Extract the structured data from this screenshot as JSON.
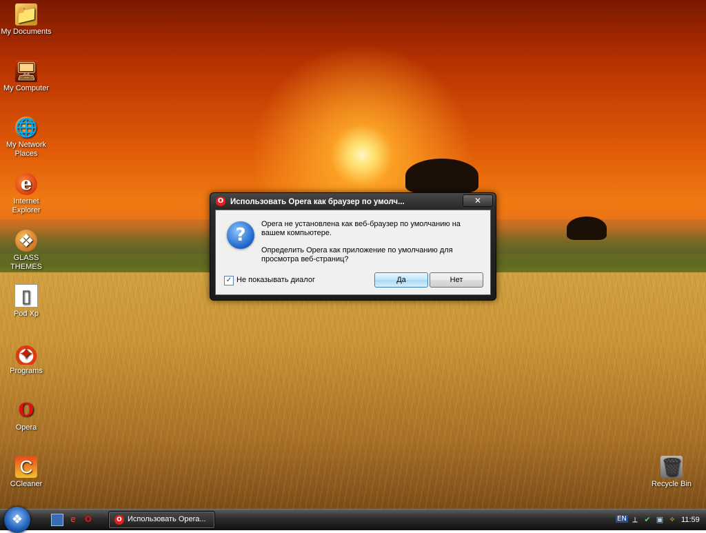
{
  "desktop": {
    "icons": [
      {
        "label": "My Documents",
        "icon": "folder-documents-icon",
        "glyph": "📁"
      },
      {
        "label": "My Computer",
        "icon": "computer-icon",
        "glyph": "🖥"
      },
      {
        "label": "My Network Places",
        "icon": "network-icon",
        "glyph": "🌐"
      },
      {
        "label": "Internet Explorer",
        "icon": "internet-explorer-icon",
        "glyph": "e"
      },
      {
        "label": "GLASS THEMES",
        "icon": "glass-themes-icon",
        "glyph": "❖"
      },
      {
        "label": "Pod Xp",
        "icon": "pod-xp-icon",
        "glyph": "▯"
      },
      {
        "label": "Programs",
        "icon": "programs-icon",
        "glyph": "✦"
      },
      {
        "label": "Opera",
        "icon": "opera-icon",
        "glyph": "O"
      },
      {
        "label": "CCleaner",
        "icon": "ccleaner-icon",
        "glyph": "C"
      }
    ],
    "recycle_bin": {
      "label": "Recycle Bin",
      "icon": "recycle-bin-icon",
      "glyph": "🗑"
    }
  },
  "dialog": {
    "title": "Использовать Opera как браузер по умолч...",
    "close_glyph": "✕",
    "icon": "question-icon",
    "message_line1": "Opera не установлена как веб-браузер по умолчанию на",
    "message_line2": "вашем компьютере.",
    "message_line3": "Определить Opera как приложение по умолчанию для",
    "message_line4": "просмотра веб-страниц?",
    "checkbox_label": "Не показывать диалог",
    "checkbox_checked": true,
    "yes_label": "Да",
    "no_label": "Нет"
  },
  "taskbar": {
    "task_label": "Использовать Opera...",
    "language": "EN",
    "clock": "11:59"
  },
  "colors": {
    "dialog_frame": "#1b1b1b",
    "accent_blue": "#1a62c8",
    "opera_red": "#e02020"
  }
}
